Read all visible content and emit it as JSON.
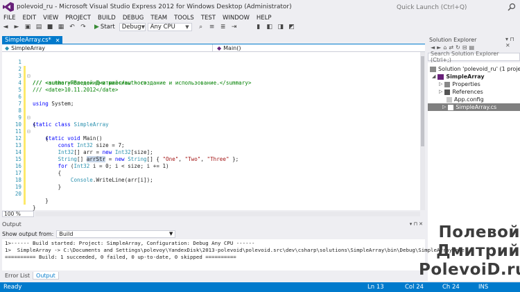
{
  "window": {
    "title": "polevoid_ru - Microsoft Visual Studio Express 2012 for Windows Desktop (Administrator)",
    "quick_launch": "Quick Launch (Ctrl+Q)"
  },
  "menu": [
    "FILE",
    "EDIT",
    "VIEW",
    "PROJECT",
    "BUILD",
    "DEBUG",
    "TEAM",
    "TOOLS",
    "TEST",
    "WINDOW",
    "HELP"
  ],
  "toolbar": {
    "start_label": "Start",
    "configuration": "Debug",
    "platform": "Any CPU"
  },
  "editor": {
    "tab": "SimpleArray.cs*",
    "nav_left": "SimpleArray",
    "nav_right": "Main()",
    "zoom": "100 %",
    "lines": [
      {
        "n": "1",
        "text": "/// <summary>Введение в массивы - создание и использование.</summary>"
      },
      {
        "n": "2",
        "text": "/// <author>Полевой Дмитрий</author>"
      },
      {
        "n": "3",
        "text": "/// <date>10.11.2012</date>"
      },
      {
        "n": "4",
        "text": ""
      },
      {
        "n": "5",
        "text": "using System;"
      },
      {
        "n": "6",
        "text": ""
      },
      {
        "n": "7",
        "text": "static class SimpleArray"
      },
      {
        "n": "8",
        "text": "{"
      },
      {
        "n": "9",
        "text": "    static void Main()"
      },
      {
        "n": "10",
        "text": "    {"
      },
      {
        "n": "11",
        "text": "        const Int32 size = 7;"
      },
      {
        "n": "12",
        "text": "        Int32[] arr = new Int32[size];"
      },
      {
        "n": "13",
        "text": "        String[] arrStr = new String[] { \"One\", \"Two\", \"Three\" };"
      },
      {
        "n": "14",
        "text": "        for (Int32 i = 0; i < size; i += 1)"
      },
      {
        "n": "15",
        "text": "        {"
      },
      {
        "n": "16",
        "text": "            Console.WriteLine(arr[i]);"
      },
      {
        "n": "17",
        "text": "        }"
      },
      {
        "n": "18",
        "text": ""
      },
      {
        "n": "19",
        "text": "    }"
      },
      {
        "n": "20",
        "text": "}"
      }
    ]
  },
  "solution_explorer": {
    "title": "Solution Explorer",
    "search_placeholder": "Search Solution Explorer (Ctrl+;)",
    "nodes": [
      {
        "label": "Solution 'polevoid_ru' (1 project)"
      },
      {
        "label": "SimpleArray"
      },
      {
        "label": "Properties"
      },
      {
        "label": "References"
      },
      {
        "label": "App.config"
      },
      {
        "label": "SimpleArray.cs"
      }
    ]
  },
  "output": {
    "title": "Output",
    "show_from_label": "Show output from:",
    "source": "Build",
    "lines": [
      "1>------ Build started: Project: SimpleArray, Configuration: Debug Any CPU ------",
      "1>  SimpleArray -> C:\\Documents and Settings\\polevoy\\YandexDisk\\2013-polevoid\\polevoid.src\\dev\\csharp\\solutions\\SimpleArray\\bin\\Debug\\SimpleArray.exe",
      "========== Build: 1 succeeded, 0 failed, 0 up-to-date, 0 skipped =========="
    ],
    "tabs": [
      "Error List",
      "Output"
    ]
  },
  "status": {
    "ready": "Ready",
    "line": "Ln 13",
    "col": "Col 24",
    "ch": "Ch 24",
    "mode": "INS"
  },
  "watermark": [
    "Полевой",
    "Дмитрий",
    "PolevoiD.ru"
  ],
  "colors": {
    "accent": "#007acc",
    "comment": "#008000",
    "keyword": "#0000ff",
    "type": "#2b91af",
    "string": "#a31515"
  }
}
